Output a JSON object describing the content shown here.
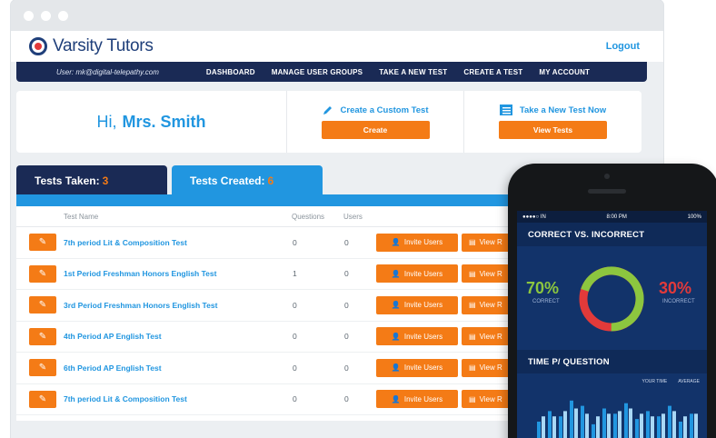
{
  "app": {
    "brand": "Varsity Tutors",
    "logout": "Logout"
  },
  "nav": {
    "user": "User: mk@digital-telepathy.com",
    "items": [
      "DASHBOARD",
      "MANAGE USER GROUPS",
      "TAKE A NEW TEST",
      "CREATE A TEST",
      "MY ACCOUNT"
    ]
  },
  "welcome": {
    "greeting": "Hi,",
    "name": "Mrs. Smith",
    "custom_link": "Create a Custom Test",
    "custom_button": "Create",
    "new_link": "Take a New Test Now",
    "new_button": "View Tests"
  },
  "tabs": {
    "taken_label": "Tests Taken:",
    "taken_count": "3",
    "created_label": "Tests Created:",
    "created_count": "6"
  },
  "table": {
    "headers": {
      "name": "Test Name",
      "questions": "Questions",
      "users": "Users"
    },
    "invite_label": "Invite Users",
    "view_label": "View R",
    "rows": [
      {
        "name": "7th period Lit & Composition Test",
        "questions": "0",
        "users": "0"
      },
      {
        "name": "1st Period Freshman Honors English Test",
        "questions": "1",
        "users": "0"
      },
      {
        "name": "3rd Period Freshman Honors English Test",
        "questions": "0",
        "users": "0"
      },
      {
        "name": "4th Period AP English Test",
        "questions": "0",
        "users": "0"
      },
      {
        "name": "6th Period AP English Test",
        "questions": "0",
        "users": "0"
      },
      {
        "name": "7th period Lit & Composition Test",
        "questions": "0",
        "users": "0"
      }
    ]
  },
  "phone": {
    "carrier": "●●●●○ IN",
    "time": "8:00 PM",
    "battery": "100%",
    "section1_title": "CORRECT VS. INCORRECT",
    "correct_pct": "70%",
    "correct_label": "CORRECT",
    "incorrect_pct": "30%",
    "incorrect_label": "INCORRECT",
    "correct_fraction": 0.7,
    "section2_title": "TIME P/ QUESTION",
    "legend_your": "YOUR TIME",
    "legend_avg": "AVERAGE",
    "correct_color": "#8cc63f",
    "incorrect_color": "#e23a3a",
    "bars_your": [
      10,
      14,
      12,
      18,
      16,
      9,
      15,
      13,
      17,
      11,
      14,
      12,
      16,
      10,
      13
    ],
    "bars_avg": [
      12,
      12,
      14,
      15,
      13,
      12,
      13,
      14,
      15,
      13,
      12,
      13,
      14,
      12,
      13
    ]
  },
  "colors": {
    "navy": "#1a2a55",
    "blue": "#2196e0",
    "orange": "#f47b16"
  }
}
